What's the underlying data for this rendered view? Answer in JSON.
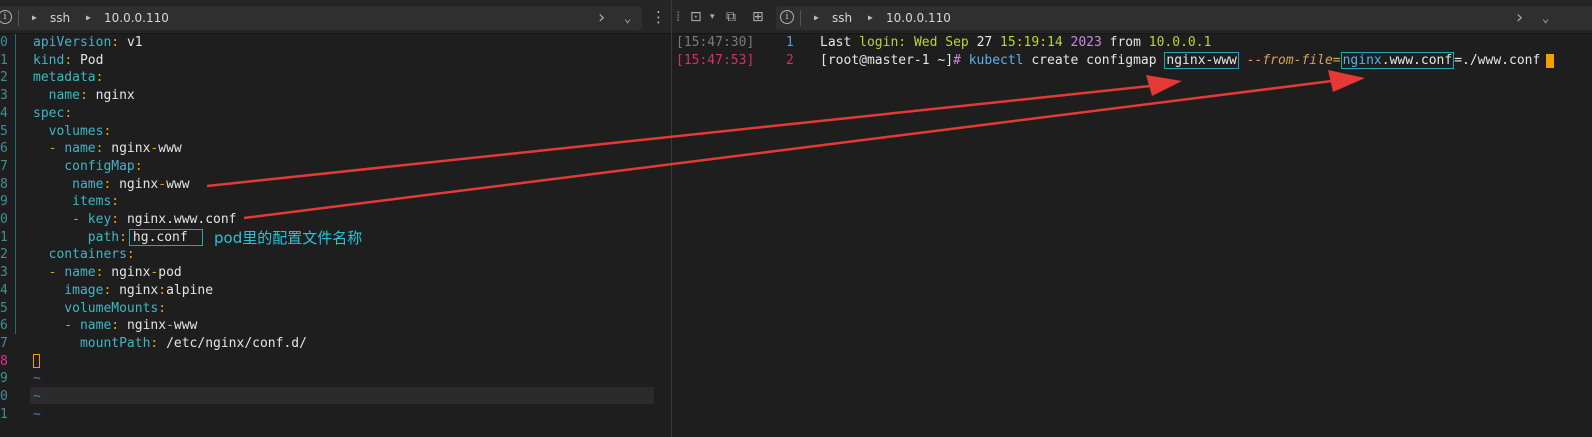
{
  "left": {
    "tab": {
      "tlabel1": "ssh",
      "tlabel2": "10.0.0.110"
    },
    "lines": [
      {
        "n": "0",
        "seg": [
          [
            "key",
            "apiVersion"
          ],
          [
            "punc",
            ": "
          ],
          [
            "val",
            "v1"
          ]
        ]
      },
      {
        "n": "1",
        "seg": [
          [
            "key",
            "kind"
          ],
          [
            "punc",
            ": "
          ],
          [
            "val",
            "Pod"
          ]
        ]
      },
      {
        "n": "2",
        "seg": [
          [
            "key",
            "metadata"
          ],
          [
            "punc",
            ":"
          ]
        ]
      },
      {
        "n": "3",
        "seg": [
          [
            "key",
            "  name"
          ],
          [
            "punc",
            ": "
          ],
          [
            "val",
            "nginx"
          ]
        ]
      },
      {
        "n": "4",
        "seg": [
          [
            "key",
            "spec"
          ],
          [
            "punc",
            ":"
          ]
        ]
      },
      {
        "n": "5",
        "seg": [
          [
            "key",
            "  volumes"
          ],
          [
            "punc",
            ":"
          ]
        ]
      },
      {
        "n": "6",
        "seg": [
          [
            "punc",
            "  - "
          ],
          [
            "key",
            "name"
          ],
          [
            "punc",
            ": "
          ],
          [
            "val",
            "nginx"
          ],
          [
            "punc",
            "-"
          ],
          [
            "val",
            "www"
          ]
        ]
      },
      {
        "n": "7",
        "seg": [
          [
            "key",
            "    configMap"
          ],
          [
            "punc",
            ":"
          ]
        ]
      },
      {
        "n": "8",
        "seg": [
          [
            "key",
            "     name"
          ],
          [
            "punc",
            ": "
          ],
          [
            "val",
            "nginx"
          ],
          [
            "punc",
            "-"
          ],
          [
            "val",
            "www"
          ]
        ]
      },
      {
        "n": "9",
        "seg": [
          [
            "key",
            "     items"
          ],
          [
            "punc",
            ":"
          ]
        ]
      },
      {
        "n": "0",
        "seg": [
          [
            "punc",
            "     - "
          ],
          [
            "key",
            "key"
          ],
          [
            "punc",
            ": "
          ],
          [
            "val",
            "nginx.www.conf"
          ]
        ]
      },
      {
        "n": "1",
        "seg": [
          [
            "key",
            "       path"
          ],
          [
            "punc",
            ":"
          ],
          [
            "box",
            "hg.conf"
          ]
        ]
      },
      {
        "n": "2",
        "seg": [
          [
            "key",
            "  containers"
          ],
          [
            "punc",
            ":"
          ]
        ]
      },
      {
        "n": "3",
        "seg": [
          [
            "punc",
            "  - "
          ],
          [
            "key",
            "name"
          ],
          [
            "punc",
            ": "
          ],
          [
            "val",
            "nginx"
          ],
          [
            "punc",
            "-"
          ],
          [
            "val",
            "pod"
          ]
        ]
      },
      {
        "n": "4",
        "seg": [
          [
            "key",
            "    image"
          ],
          [
            "punc",
            ": "
          ],
          [
            "val",
            "nginx"
          ],
          [
            "punc",
            ":"
          ],
          [
            "val",
            "alpine"
          ]
        ]
      },
      {
        "n": "5",
        "seg": [
          [
            "key",
            "    volumeMounts"
          ],
          [
            "punc",
            ":"
          ]
        ]
      },
      {
        "n": "6",
        "seg": [
          [
            "punc",
            "    - "
          ],
          [
            "key",
            "name"
          ],
          [
            "punc",
            ": "
          ],
          [
            "val",
            "nginx"
          ],
          [
            "punc",
            "-"
          ],
          [
            "val",
            "www"
          ]
        ]
      },
      {
        "n": "7",
        "seg": [
          [
            "key",
            "      mountPath"
          ],
          [
            "punc",
            ": "
          ],
          [
            "val",
            "/etc/nginx/conf.d/"
          ]
        ]
      },
      {
        "n": "8",
        "cur": true,
        "seg": [
          [
            "cursor",
            ""
          ]
        ]
      },
      {
        "n": "9",
        "seg": [
          [
            "tilde",
            "~"
          ]
        ]
      },
      {
        "n": "0",
        "seg": [
          [
            "tilde",
            "~"
          ]
        ]
      },
      {
        "n": "1",
        "seg": [
          [
            "tilde",
            "~"
          ]
        ]
      }
    ],
    "annotation": "pod里的配置文件名称"
  },
  "right": {
    "tab": {
      "tlabel1": "ssh",
      "tlabel2": "10.0.0.110"
    },
    "lines": [
      {
        "ts": "[15:47:30]",
        "n": "1",
        "seg": [
          [
            "kw-w",
            "Last "
          ],
          [
            "kw-g",
            "login"
          ],
          [
            "kw-y",
            ": "
          ],
          [
            "kw-g",
            "Wed Sep "
          ],
          [
            "kw-w",
            "27 "
          ],
          [
            "kw-g",
            "15"
          ],
          [
            "kw-y",
            ":"
          ],
          [
            "kw-g",
            "19"
          ],
          [
            "kw-y",
            ":"
          ],
          [
            "kw-g",
            "14 "
          ],
          [
            "kw-p",
            "2023 "
          ],
          [
            "kw-w",
            "from "
          ],
          [
            "kw-g",
            "10.0.0.1"
          ]
        ]
      },
      {
        "ts": "[15:47:53]",
        "n": "2",
        "err": true,
        "seg": [
          [
            "kw-w",
            "[root@master-1 ~]"
          ],
          [
            "kw-p",
            "# "
          ],
          [
            "kw-b",
            "kubectl "
          ],
          [
            "kw-w",
            "create configmap "
          ],
          [
            "box",
            "nginx-www"
          ],
          [
            "kw-w",
            " "
          ],
          [
            "kw-flag",
            "--from-file="
          ],
          [
            "boxb",
            "nginx"
          ],
          [
            "kw-w",
            ".www.conf"
          ],
          [
            "closebox",
            ""
          ],
          [
            "kw-w",
            "=./www.conf"
          ],
          [
            "tcursor",
            ""
          ]
        ]
      }
    ]
  },
  "colors": {
    "arrow": "#e53935",
    "accent": "#1fa9b8",
    "cursor": "#f0a000"
  }
}
